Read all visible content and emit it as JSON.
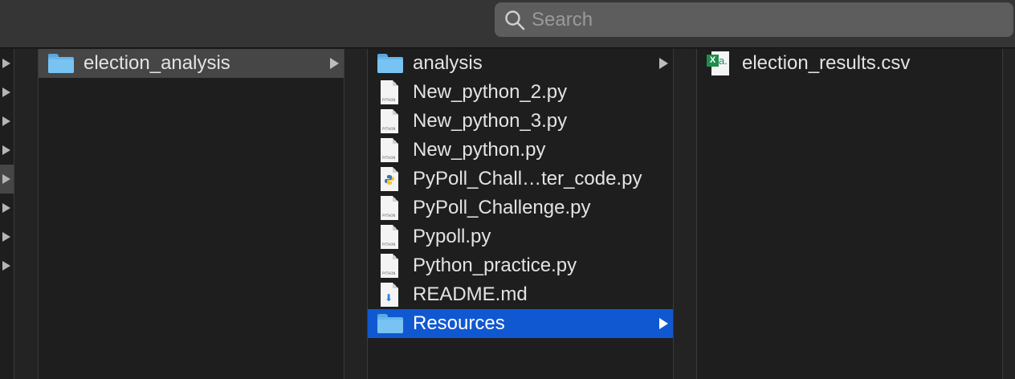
{
  "search": {
    "placeholder": "Search",
    "value": ""
  },
  "column1": {
    "items": [
      {
        "label": "election_analysis",
        "icon": "folder-icon",
        "selected": true,
        "has_children": true
      }
    ]
  },
  "column2": {
    "items": [
      {
        "label": "analysis",
        "icon": "folder-icon",
        "has_children": true
      },
      {
        "label": "New_python_2.py",
        "icon": "python-doc-icon"
      },
      {
        "label": "New_python_3.py",
        "icon": "python-doc-icon"
      },
      {
        "label": "New_python.py",
        "icon": "python-doc-icon"
      },
      {
        "label": "PyPoll_Chall…ter_code.py",
        "icon": "python-logo-icon"
      },
      {
        "label": "PyPoll_Challenge.py",
        "icon": "python-doc-icon"
      },
      {
        "label": "Pypoll.py",
        "icon": "python-doc-icon"
      },
      {
        "label": "Python_practice.py",
        "icon": "python-doc-icon"
      },
      {
        "label": "README.md",
        "icon": "markdown-doc-icon"
      },
      {
        "label": "Resources",
        "icon": "folder-icon",
        "selected": true,
        "has_children": true
      }
    ]
  },
  "column3": {
    "items": [
      {
        "label": "election_results.csv",
        "icon": "excel-csv-icon"
      }
    ]
  },
  "colors": {
    "selection_blue": "#1058d1",
    "selection_gray": "#464646",
    "folder_blue": "#64b6ec"
  }
}
